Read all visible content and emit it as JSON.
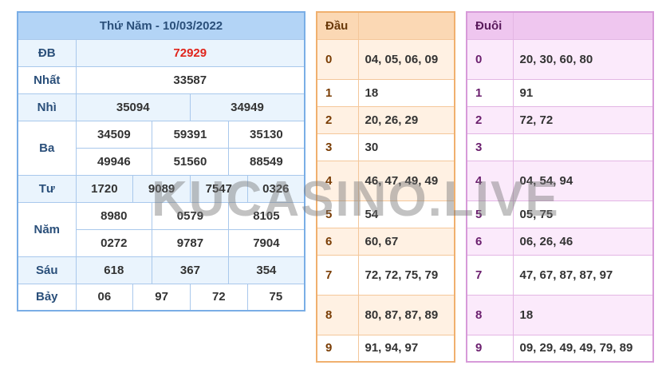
{
  "results": {
    "title": "Thứ Năm - 10/03/2022",
    "rows": {
      "db": {
        "label": "ĐB",
        "values": [
          "72929"
        ]
      },
      "nhat": {
        "label": "Nhất",
        "values": [
          "33587"
        ]
      },
      "nhi": {
        "label": "Nhì",
        "values": [
          "35094",
          "34949"
        ]
      },
      "ba": {
        "label": "Ba",
        "values": [
          "34509",
          "59391",
          "35130",
          "49946",
          "51560",
          "88549"
        ]
      },
      "tu": {
        "label": "Tư",
        "values": [
          "1720",
          "9089",
          "7547",
          "0326"
        ]
      },
      "nam": {
        "label": "Năm",
        "values": [
          "8980",
          "0579",
          "8105",
          "0272",
          "9787",
          "7904"
        ]
      },
      "sau": {
        "label": "Sáu",
        "values": [
          "618",
          "367",
          "354"
        ]
      },
      "bay": {
        "label": "Bảy",
        "values": [
          "06",
          "97",
          "72",
          "75"
        ]
      }
    }
  },
  "dau": {
    "header": "Đầu",
    "rows": [
      {
        "num": "0",
        "val": "04, 05, 06, 09"
      },
      {
        "num": "1",
        "val": "18"
      },
      {
        "num": "2",
        "val": "20, 26, 29"
      },
      {
        "num": "3",
        "val": "30"
      },
      {
        "num": "4",
        "val": "46, 47, 49, 49"
      },
      {
        "num": "5",
        "val": "54"
      },
      {
        "num": "6",
        "val": "60, 67"
      },
      {
        "num": "7",
        "val": "72, 72, 75, 79"
      },
      {
        "num": "8",
        "val": "80, 87, 87, 89"
      },
      {
        "num": "9",
        "val": "91, 94, 97"
      }
    ]
  },
  "duoi": {
    "header": "Đuôi",
    "rows": [
      {
        "num": "0",
        "val": "20, 30, 60, 80"
      },
      {
        "num": "1",
        "val": "91"
      },
      {
        "num": "2",
        "val": "72, 72"
      },
      {
        "num": "3",
        "val": ""
      },
      {
        "num": "4",
        "val": "04, 54, 94"
      },
      {
        "num": "5",
        "val": "05, 75"
      },
      {
        "num": "6",
        "val": "06, 26, 46"
      },
      {
        "num": "7",
        "val": "47, 67, 87, 87, 97"
      },
      {
        "num": "8",
        "val": "18"
      },
      {
        "num": "9",
        "val": "09, 29, 49, 49, 79, 89"
      }
    ]
  },
  "watermark": "KUCASINO.LIVE",
  "colors": {
    "special_prize": "#e0241b",
    "results_border": "#7aaee6",
    "dau_border": "#f0b06e",
    "duoi_border": "#d79ad9"
  }
}
